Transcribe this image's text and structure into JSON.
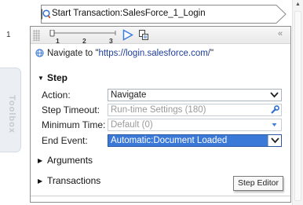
{
  "transaction": {
    "label": "Start Transaction:SalesForce_1_Login",
    "icon": "transaction-start-icon"
  },
  "step": {
    "number": "1",
    "timeline_ticks": [
      "1",
      "2",
      "3"
    ],
    "summary_prefix": "Navigate to \"",
    "summary_url": "https://login.salesforce.com/",
    "summary_suffix": "\"",
    "section_title": "Step",
    "fields": {
      "action": {
        "label": "Action:",
        "value": "Navigate"
      },
      "timeout": {
        "label": "Step Timeout:",
        "value": "Run-time Settings (180)"
      },
      "min_time": {
        "label": "Minimum Time:",
        "value": "Default (0)"
      },
      "end_event": {
        "label": "End Event:",
        "value": "Automatic:Document Loaded"
      }
    },
    "arguments_label": "Arguments",
    "transactions_label": "Transactions"
  },
  "toolbox": {
    "label": "Toolbox"
  },
  "tooltip": {
    "text": "Step Editor"
  },
  "colors": {
    "link": "#1f3f9a",
    "selection": "#3a79d7",
    "play": "#3b7de0",
    "wrench": "#2f6fd6"
  },
  "icons": [
    "transaction-start-icon",
    "play-icon",
    "snapshot-icon",
    "collapse-icon",
    "globe-icon",
    "wrench-icon",
    "dropdown-arrow-icon",
    "triangle-icon"
  ]
}
